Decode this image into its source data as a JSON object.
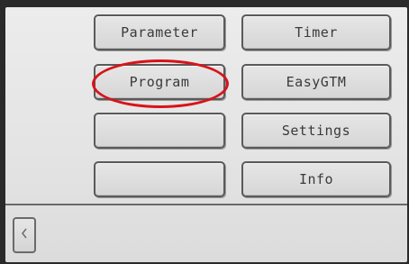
{
  "menu": {
    "items": [
      {
        "label": "Parameter"
      },
      {
        "label": "Program"
      },
      {
        "label": ""
      },
      {
        "label": ""
      },
      {
        "label": "Timer"
      },
      {
        "label": "EasyGTM"
      },
      {
        "label": "Settings"
      },
      {
        "label": "Info"
      }
    ]
  },
  "footer": {
    "back_icon": "chevron-left-icon"
  },
  "annotation": {
    "color": "#d7141a"
  }
}
